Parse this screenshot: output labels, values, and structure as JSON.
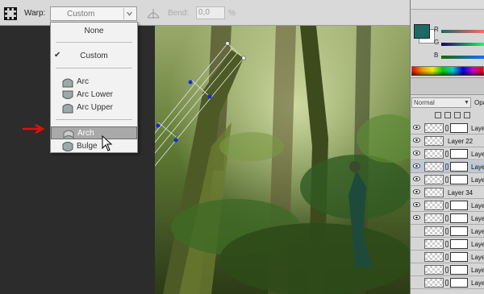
{
  "options_bar": {
    "warp_label": "Warp:",
    "warp_value": "Custom",
    "bend_label": "Bend:",
    "bend_value": "0,0",
    "bend_unit": "%"
  },
  "warp_menu": {
    "items": [
      {
        "label": "None",
        "icon": "none"
      },
      {
        "label": "Custom",
        "icon": "check-icon",
        "checked": true
      },
      {
        "label": "Arc",
        "icon": "arc-icon"
      },
      {
        "label": "Arc Lower",
        "icon": "arc-lower-icon"
      },
      {
        "label": "Arc Upper",
        "icon": "arc-upper-icon"
      },
      {
        "label": "Arch",
        "icon": "arch-icon",
        "selected": true
      },
      {
        "label": "Bulge",
        "icon": "bulge-icon"
      }
    ]
  },
  "color_panel": {
    "channels": [
      "R",
      "G",
      "B"
    ],
    "foreground": "#1b6a63",
    "background": "#ffffff"
  },
  "layers_panel": {
    "blend_mode": "Normal",
    "opacity_label": "Opa",
    "layers": [
      {
        "name": "Laye",
        "has_mask": true,
        "visible": true
      },
      {
        "name": "Layer 22",
        "has_mask": false,
        "visible": true
      },
      {
        "name": "Laye",
        "has_mask": true,
        "visible": true
      },
      {
        "name": "Laye",
        "has_mask": true,
        "visible": true,
        "active": true
      },
      {
        "name": "Laye",
        "has_mask": true,
        "visible": true
      },
      {
        "name": "Layer 34",
        "has_mask": false,
        "visible": true
      },
      {
        "name": "Laye",
        "has_mask": true,
        "visible": true
      },
      {
        "name": "Laye",
        "has_mask": true,
        "visible": true
      },
      {
        "name": "Laye",
        "has_mask": true,
        "visible": false
      },
      {
        "name": "Laye",
        "has_mask": true,
        "visible": false
      },
      {
        "name": "Laye",
        "has_mask": true,
        "visible": false
      },
      {
        "name": "Laye",
        "has_mask": true,
        "visible": false
      },
      {
        "name": "Laye",
        "has_mask": true,
        "visible": false
      }
    ]
  }
}
